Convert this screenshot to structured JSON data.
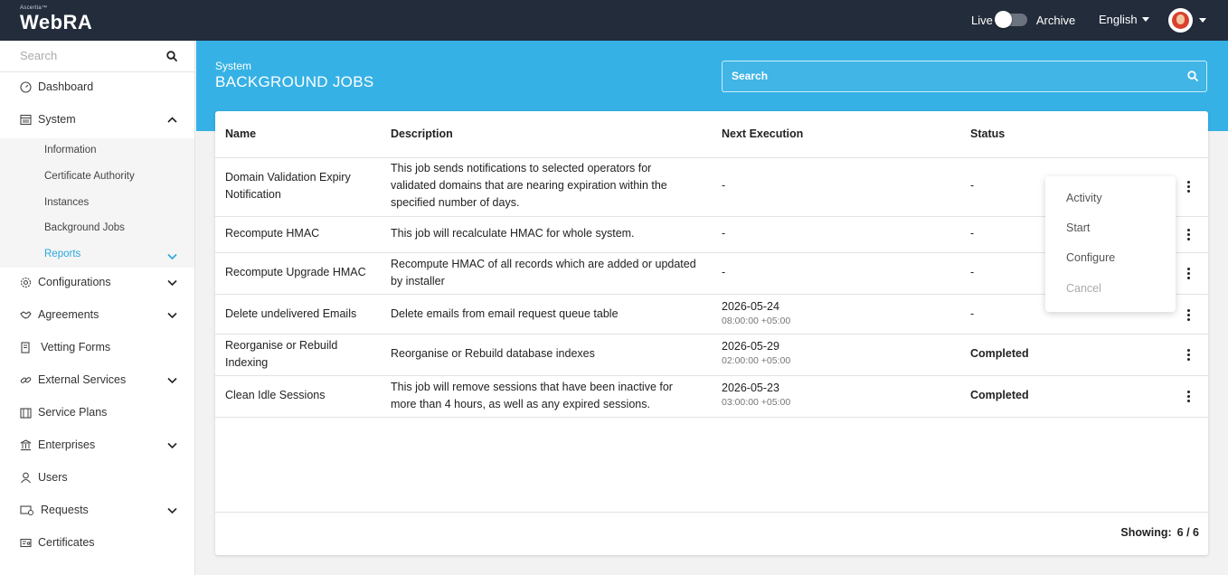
{
  "topbar": {
    "brand_small": "Ascertia™",
    "brand_name": "WebRA",
    "live_label": "Live",
    "archive_label": "Archive",
    "language": "English"
  },
  "sidebar": {
    "search_placeholder": "Search",
    "items": [
      {
        "label": "Dashboard",
        "icon": "dashboard-icon"
      },
      {
        "label": "System",
        "icon": "system-icon",
        "expanded": true
      },
      {
        "label": "Configurations",
        "icon": "gear-icon"
      },
      {
        "label": "Agreements",
        "icon": "handshake-icon"
      },
      {
        "label": "Vetting Forms",
        "icon": "form-icon"
      },
      {
        "label": "External Services",
        "icon": "link-icon"
      },
      {
        "label": "Service Plans",
        "icon": "service-plans-icon"
      },
      {
        "label": "Enterprises",
        "icon": "bank-icon"
      },
      {
        "label": "Users",
        "icon": "user-icon"
      },
      {
        "label": "Requests",
        "icon": "requests-icon"
      },
      {
        "label": "Certificates",
        "icon": "certificate-icon"
      }
    ],
    "system_sub": [
      {
        "label": "Information"
      },
      {
        "label": "Certificate Authority"
      },
      {
        "label": "Instances"
      },
      {
        "label": "Background Jobs"
      },
      {
        "label": "Reports",
        "active": true
      }
    ]
  },
  "banner": {
    "section": "System",
    "title": "BACKGROUND JOBS",
    "search_placeholder": "Search"
  },
  "table": {
    "headers": {
      "name": "Name",
      "description": "Description",
      "next_execution": "Next Execution",
      "status": "Status"
    },
    "rows": [
      {
        "name": "Domain Validation Expiry Notification",
        "description": "This job sends notifications to selected operators for validated domains that are nearing expiration within the specified number of days.",
        "next_date": "-",
        "next_time": "",
        "status": "-"
      },
      {
        "name": "Recompute HMAC",
        "description": "This job will recalculate HMAC for whole system.",
        "next_date": "-",
        "next_time": "",
        "status": "-"
      },
      {
        "name": "Recompute Upgrade HMAC",
        "description": "Recompute HMAC of all records which are added or updated by installer",
        "next_date": "-",
        "next_time": "",
        "status": "-"
      },
      {
        "name": "Delete undelivered Emails",
        "description": "Delete emails from email request queue table",
        "next_date": "2026-05-24",
        "next_time": "08:00:00 +05:00",
        "status": "-"
      },
      {
        "name": "Reorganise or Rebuild Indexing",
        "description": "Reorganise or Rebuild database indexes",
        "next_date": "2026-05-29",
        "next_time": "02:00:00 +05:00",
        "status": "Completed"
      },
      {
        "name": "Clean Idle Sessions",
        "description": "This job will remove sessions that have been inactive for more than 4 hours, as well as any expired sessions.",
        "next_date": "2026-05-23",
        "next_time": "03:00:00 +05:00",
        "status": "Completed"
      }
    ],
    "footer": {
      "showing_label": "Showing:",
      "count": "6 / 6"
    }
  },
  "row_menu": {
    "items": [
      {
        "label": "Activity",
        "enabled": true
      },
      {
        "label": "Start",
        "enabled": true
      },
      {
        "label": "Configure",
        "enabled": true
      },
      {
        "label": "Cancel",
        "enabled": false
      }
    ]
  },
  "colors": {
    "topbar": "#232c3b",
    "banner": "#36b1e5",
    "accent": "#2aa7df"
  }
}
